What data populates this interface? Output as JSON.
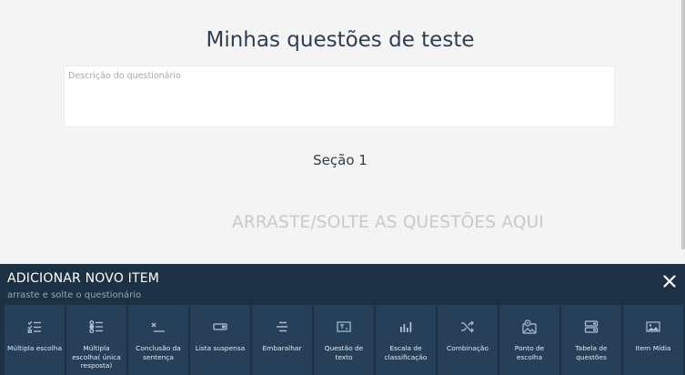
{
  "quiz": {
    "title": "Minhas questões de teste",
    "description_placeholder": "Descrição do questionário",
    "description_value": "",
    "section_title": "Seção 1",
    "drop_hint": "ARRASTE/SOLTE AS QUESTÕES AQUI"
  },
  "panel": {
    "title": "ADICIONAR NOVO ITEM",
    "subtitle": "arraste e solte o questionário",
    "close_icon": "close-icon",
    "items": [
      {
        "label": "Múltipla escolha",
        "icon": "checklist-icon"
      },
      {
        "label": "Múltipla escolha( única resposta)",
        "icon": "radio-list-icon"
      },
      {
        "label": "Conclusão da sentença",
        "icon": "fill-blank-icon"
      },
      {
        "label": "Lista suspensa",
        "icon": "dropdown-icon"
      },
      {
        "label": "Embaralhar",
        "icon": "shuffle-lines-icon"
      },
      {
        "label": "Questão de texto",
        "icon": "text-box-icon"
      },
      {
        "label": "Escala de classificação",
        "icon": "bar-scale-icon"
      },
      {
        "label": "Combinação",
        "icon": "match-icon"
      },
      {
        "label": "Ponto de escolha",
        "icon": "image-pin-icon"
      },
      {
        "label": "Tabela de questões",
        "icon": "table-icon"
      },
      {
        "label": "Item Mídia",
        "icon": "media-icon"
      }
    ]
  },
  "colors": {
    "page_bg": "#f4f4f4",
    "panel_bg": "#1d3145",
    "tile_bg": "#264059",
    "title_text": "#2e3e4e",
    "drop_hint": "#c9c9c9",
    "icon": "#a9c2da"
  }
}
